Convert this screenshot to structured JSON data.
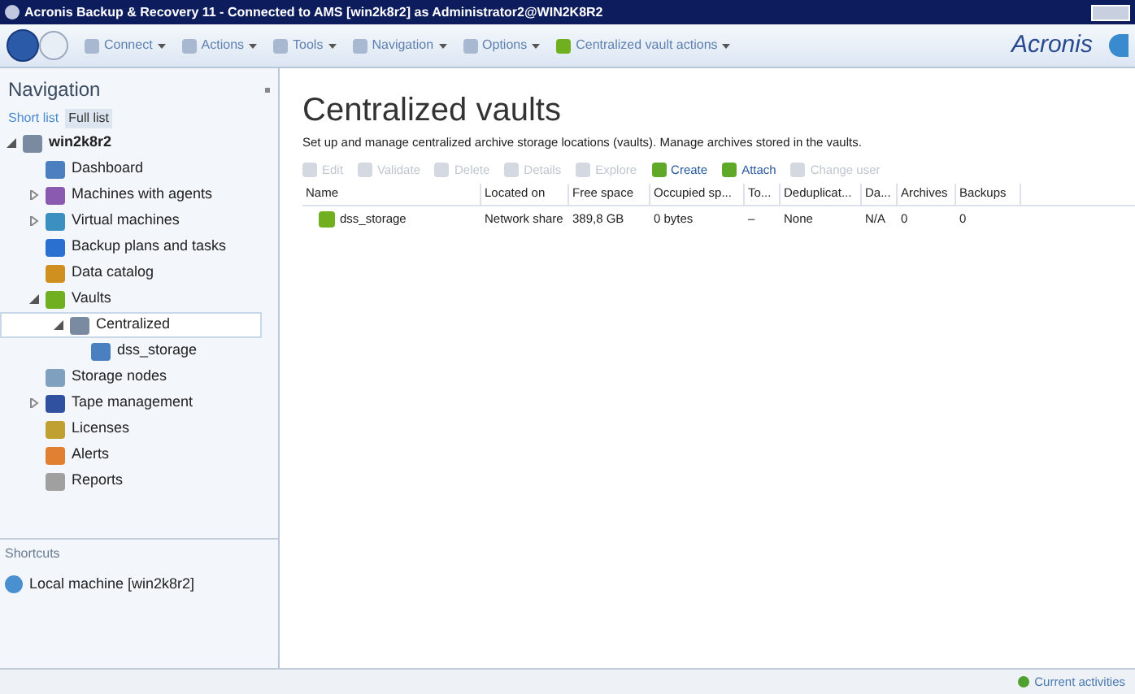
{
  "window": {
    "title": "Acronis Backup & Recovery 11 - Connected to AMS [win2k8r2] as Administrator2@WIN2K8R2"
  },
  "menu": [
    {
      "label": "Connect"
    },
    {
      "label": "Actions"
    },
    {
      "label": "Tools"
    },
    {
      "label": "Navigation"
    },
    {
      "label": "Options"
    },
    {
      "label": "Centralized vault actions"
    }
  ],
  "brand": "Acronis",
  "navigation": {
    "title": "Navigation",
    "views": [
      {
        "label": "Short list",
        "selected": false
      },
      {
        "label": "Full list",
        "selected": true
      }
    ],
    "tree": [
      {
        "label": "win2k8r2",
        "expanded": true,
        "selected": false,
        "children": [
          {
            "label": "Dashboard",
            "selected": false
          },
          {
            "label": "Machines with agents",
            "expanded": false,
            "selected": false
          },
          {
            "label": "Virtual machines",
            "expanded": false,
            "selected": false
          },
          {
            "label": "Backup plans and tasks",
            "selected": false
          },
          {
            "label": "Data catalog",
            "selected": false
          },
          {
            "label": "Vaults",
            "expanded": true,
            "selected": false,
            "children": [
              {
                "label": "Centralized",
                "expanded": true,
                "selected": true,
                "children": [
                  {
                    "label": "dss_storage",
                    "selected": false
                  }
                ]
              }
            ]
          },
          {
            "label": "Storage nodes",
            "selected": false
          },
          {
            "label": "Tape management",
            "expanded": false,
            "selected": false
          },
          {
            "label": "Licenses",
            "selected": false
          },
          {
            "label": "Alerts",
            "selected": false
          },
          {
            "label": "Reports",
            "selected": false
          }
        ]
      }
    ]
  },
  "shortcuts": {
    "title": "Shortcuts",
    "items": [
      "Local machine [win2k8r2]"
    ]
  },
  "page": {
    "title": "Centralized vaults",
    "description": "Set up and manage centralized archive storage locations (vaults). Manage archives stored in the vaults.",
    "actions": [
      {
        "label": "Edit",
        "disabled": true
      },
      {
        "label": "Validate",
        "disabled": true
      },
      {
        "label": "Delete",
        "disabled": true
      },
      {
        "label": "Details",
        "disabled": true
      },
      {
        "label": "Explore",
        "disabled": true
      },
      {
        "label": "Create",
        "disabled": false
      },
      {
        "label": "Attach",
        "disabled": false
      },
      {
        "label": "Change user",
        "disabled": true
      }
    ]
  },
  "table": {
    "columns": [
      "Name",
      "Located on",
      "Free space",
      "Occupied sp...",
      "To...",
      "Deduplicat...",
      "Da...",
      "Archives",
      "Backups"
    ],
    "rows": [
      {
        "selected": false,
        "cells": [
          "dss_storage",
          "Network share",
          "389,8 GB",
          "0 bytes",
          "–",
          "None",
          "N/A",
          "0",
          "0"
        ]
      }
    ]
  },
  "status_bar": {
    "label": "Current activities"
  }
}
